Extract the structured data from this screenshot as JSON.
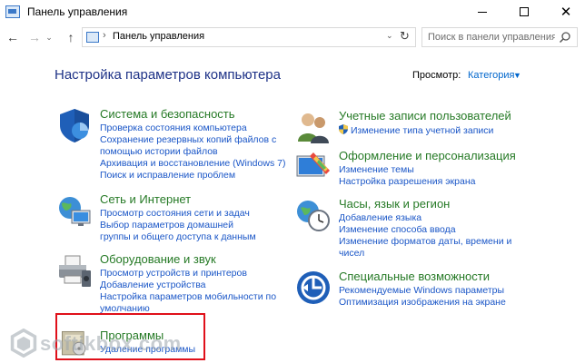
{
  "window": {
    "title": "Панель управления",
    "minimize_glyph": "—",
    "maximize_glyph": "□",
    "close_glyph": "✕"
  },
  "nav": {
    "back_glyph": "←",
    "forward_glyph": "→",
    "recent_glyph": "⌄",
    "up_glyph": "↑",
    "breadcrumb_sep": "›",
    "breadcrumb": "Панель управления",
    "dropdown_glyph": "⌄",
    "refresh_glyph": "↻",
    "search_placeholder": "Поиск в панели управления"
  },
  "header": {
    "title": "Настройка параметров компьютера",
    "view_label": "Просмотр:",
    "view_value": "Категория",
    "view_caret": "▼"
  },
  "categories": {
    "system": {
      "title": "Система и безопасность",
      "icon": "shield-icon",
      "links": [
        "Проверка состояния компьютера",
        "Сохранение резервных копий файлов с помощью истории файлов",
        "Архивация и восстановление (Windows 7)",
        "Поиск и исправление проблем"
      ]
    },
    "network": {
      "title": "Сеть и Интернет",
      "icon": "globe-network-icon",
      "links": [
        "Просмотр состояния сети и задач",
        "Выбор параметров домашней группы и общего доступа к данным"
      ]
    },
    "hardware": {
      "title": "Оборудование и звук",
      "icon": "printer-icon",
      "links": [
        "Просмотр устройств и принтеров",
        "Добавление устройства",
        "Настройка параметров мобильности по умолчанию"
      ]
    },
    "programs": {
      "title": "Программы",
      "icon": "programs-icon",
      "links": [
        "Удаление программы"
      ]
    },
    "accounts": {
      "title": "Учетные записи пользователей",
      "icon": "users-icon",
      "links": [
        "Изменение типа учетной записи"
      ]
    },
    "appearance": {
      "title": "Оформление и персонализация",
      "icon": "appearance-icon",
      "links": [
        "Изменение темы",
        "Настройка разрешения экрана"
      ]
    },
    "clock": {
      "title": "Часы, язык и регион",
      "icon": "clock-globe-icon",
      "links": [
        "Добавление языка",
        "Изменение способа ввода",
        "Изменение форматов даты, времени и чисел"
      ]
    },
    "access": {
      "title": "Специальные возможности",
      "icon": "ease-of-access-icon",
      "links": [
        "Рекомендуемые Windows параметры",
        "Оптимизация изображения на экране"
      ]
    }
  },
  "watermark": {
    "text": "softikbox.com"
  },
  "colors": {
    "heading": "#1e3287",
    "category_title": "#267a26",
    "link": "#1a56c7",
    "highlight": "#e0101a"
  }
}
